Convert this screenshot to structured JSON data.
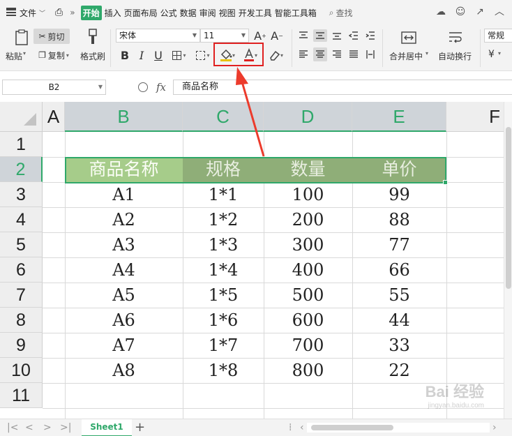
{
  "menu": {
    "file": "文件",
    "tabs": [
      "开始",
      "插入",
      "页面布局",
      "公式",
      "数据",
      "审阅",
      "视图",
      "开发工具",
      "智能工具箱"
    ],
    "active_tab": "开始",
    "search": "查找"
  },
  "ribbon": {
    "paste": "粘贴",
    "cut": "剪切",
    "copy": "复制",
    "format_painter": "格式刷",
    "font_name": "宋体",
    "font_size": "11",
    "bold": "B",
    "italic": "I",
    "underline": "U",
    "merge_center": "合并居中",
    "wrap_text": "自动换行",
    "number_format": "常规",
    "currency": "¥"
  },
  "formula_bar": {
    "name_box": "B2",
    "fx": "fx",
    "content": "商品名称"
  },
  "grid": {
    "columns": [
      "A",
      "B",
      "C",
      "D",
      "E",
      "F"
    ],
    "rows": [
      "1",
      "2",
      "3",
      "4",
      "5",
      "6",
      "7",
      "8",
      "9",
      "10",
      "11"
    ],
    "header_row": [
      "商品名称",
      "规格",
      "数量",
      "单价"
    ],
    "data_rows": [
      [
        "A1",
        "1*1",
        "100",
        "99"
      ],
      [
        "A2",
        "1*2",
        "200",
        "88"
      ],
      [
        "A3",
        "1*3",
        "300",
        "77"
      ],
      [
        "A4",
        "1*4",
        "400",
        "66"
      ],
      [
        "A5",
        "1*5",
        "500",
        "55"
      ],
      [
        "A6",
        "1*6",
        "600",
        "44"
      ],
      [
        "A7",
        "1*7",
        "700",
        "33"
      ],
      [
        "A8",
        "1*8",
        "800",
        "22"
      ]
    ],
    "colors": {
      "header_fill_first": "#a6cc8a",
      "header_fill_rest": "#8fae78",
      "selection": "#2fa86a"
    }
  },
  "sheet_tabs": {
    "active": "Sheet1"
  },
  "watermark": {
    "main": "Bai 经验",
    "sub": "jingyan.baidu.com"
  }
}
